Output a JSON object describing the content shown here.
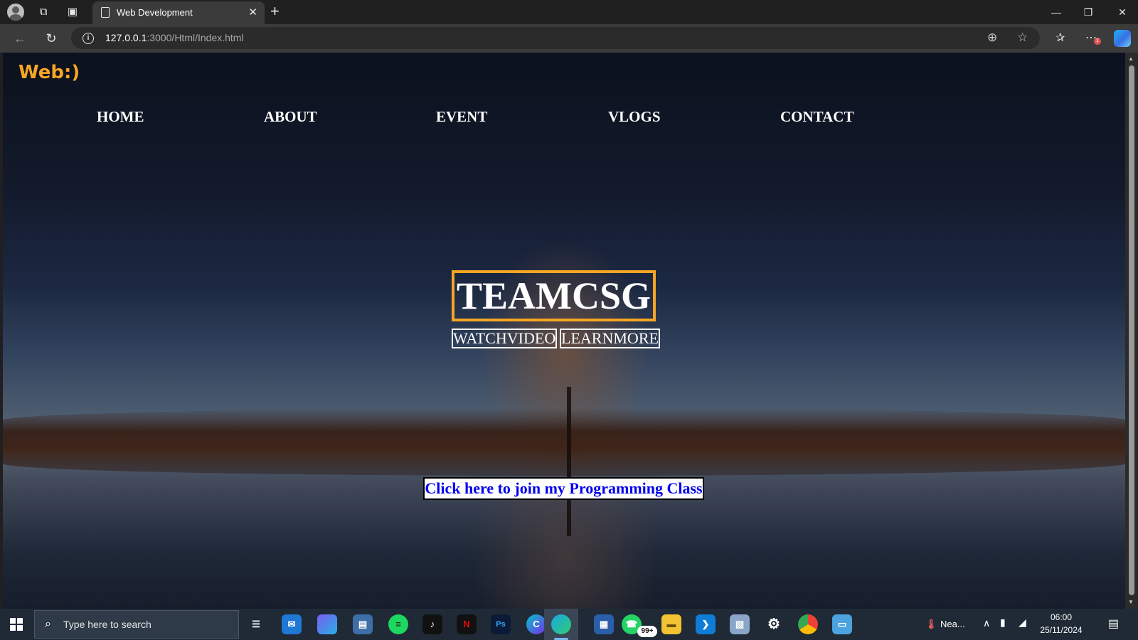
{
  "browser": {
    "tab_title": "Web Development",
    "url_host": "127.0.0.1",
    "url_path": ":3000/Html/Index.html",
    "extension_badge": "1"
  },
  "site": {
    "logo": "Web:)",
    "nav": [
      "HOME",
      "ABOUT",
      "EVENT",
      "VLOGS",
      "CONTACT"
    ],
    "hero_title": "TEAMCSG",
    "buttons": [
      "WATCHVIDEO",
      "LEARNMORE"
    ],
    "join_link": "Click here to join my Programming Class",
    "colors": {
      "accent": "#f6a623",
      "link": "#0000ee"
    }
  },
  "taskbar": {
    "search_placeholder": "Type here to search",
    "apps": [
      "task-view",
      "mail",
      "copilot",
      "remote-desktop",
      "spotify",
      "tiktok",
      "netflix",
      "photoshop",
      "canva",
      "edge",
      "store",
      "whatsapp",
      "file-explorer",
      "vscode",
      "paint",
      "settings",
      "chrome",
      "window-app"
    ],
    "notification_badge": "99+",
    "weather_text": "Nea...",
    "time": "06:00",
    "date": "25/11/2024"
  }
}
